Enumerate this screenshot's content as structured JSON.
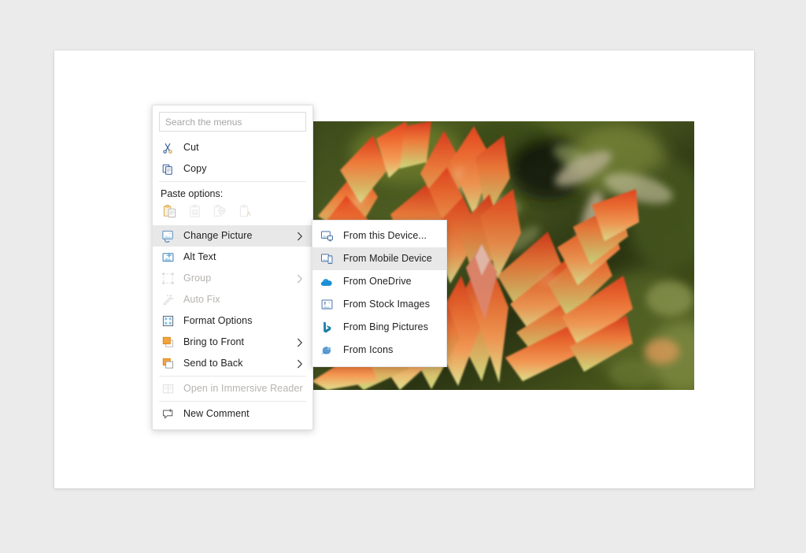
{
  "app": {
    "background_color": "#ebebeb",
    "page_color": "#ffffff"
  },
  "search": {
    "placeholder": "Search the menus",
    "value": ""
  },
  "context_menu": {
    "items": [
      {
        "id": "cut",
        "label": "Cut",
        "icon": "scissors-icon",
        "disabled": false,
        "submenu": false,
        "selected": false
      },
      {
        "id": "copy",
        "label": "Copy",
        "icon": "copy-icon",
        "disabled": false,
        "submenu": false,
        "selected": false
      }
    ],
    "paste_options_label": "Paste options:",
    "paste_options": [
      {
        "id": "paste-keep-source-formatting",
        "icon": "clipboard-source-formatting-icon",
        "enabled": true
      },
      {
        "id": "paste-picture",
        "icon": "clipboard-picture-icon",
        "enabled": false
      },
      {
        "id": "paste-merge-formatting",
        "icon": "clipboard-merge-formatting-icon",
        "enabled": false
      },
      {
        "id": "paste-keep-text-only",
        "icon": "clipboard-text-only-icon",
        "enabled": false
      }
    ],
    "items2": [
      {
        "id": "change-picture",
        "label": "Change Picture",
        "icon": "change-picture-icon",
        "disabled": false,
        "submenu": true,
        "selected": true
      },
      {
        "id": "alt-text",
        "label": "Alt Text",
        "icon": "alt-text-icon",
        "disabled": false,
        "submenu": false,
        "selected": false
      },
      {
        "id": "group",
        "label": "Group",
        "icon": "group-icon",
        "disabled": true,
        "submenu": true,
        "selected": false
      },
      {
        "id": "auto-fix",
        "label": "Auto Fix",
        "icon": "auto-fix-icon",
        "disabled": true,
        "submenu": false,
        "selected": false
      },
      {
        "id": "format-options",
        "label": "Format Options",
        "icon": "format-options-icon",
        "disabled": false,
        "submenu": false,
        "selected": false
      },
      {
        "id": "bring-to-front",
        "label": "Bring to Front",
        "icon": "bring-to-front-icon",
        "disabled": false,
        "submenu": true,
        "selected": false
      },
      {
        "id": "send-to-back",
        "label": "Send to Back",
        "icon": "send-to-back-icon",
        "disabled": false,
        "submenu": true,
        "selected": false
      }
    ],
    "items3": [
      {
        "id": "open-immersive-reader",
        "label": "Open in Immersive Reader",
        "icon": "immersive-reader-icon",
        "disabled": true,
        "submenu": false,
        "selected": false
      }
    ],
    "items4": [
      {
        "id": "new-comment",
        "label": "New Comment",
        "icon": "new-comment-icon",
        "disabled": false,
        "submenu": false,
        "selected": false
      }
    ]
  },
  "submenu": {
    "title": "Change Picture",
    "items": [
      {
        "id": "from-this-device",
        "label": "From this Device...",
        "icon": "picture-device-icon",
        "selected": false
      },
      {
        "id": "from-mobile-device",
        "label": "From Mobile Device",
        "icon": "mobile-device-icon",
        "selected": true
      },
      {
        "id": "from-onedrive",
        "label": "From OneDrive",
        "icon": "onedrive-cloud-icon",
        "selected": false
      },
      {
        "id": "from-stock-images",
        "label": "From Stock Images",
        "icon": "stock-images-icon",
        "selected": false
      },
      {
        "id": "from-bing-pictures",
        "label": "From Bing Pictures",
        "icon": "bing-icon",
        "selected": false
      },
      {
        "id": "from-icons",
        "label": "From Icons",
        "icon": "icons-bird-icon",
        "selected": false
      }
    ]
  },
  "picture": {
    "alt": "Close-up photograph of an orange and yellow-green succulent plant with pointed leaves against a blurred green garden background",
    "colors": {
      "leaf_tip": "#e8522b",
      "leaf_mid": "#f08a4a",
      "leaf_base": "#d7d98a",
      "background_green": "#4a5c22",
      "background_dark": "#1d2410",
      "stem_tan": "#b5ab8a"
    }
  }
}
